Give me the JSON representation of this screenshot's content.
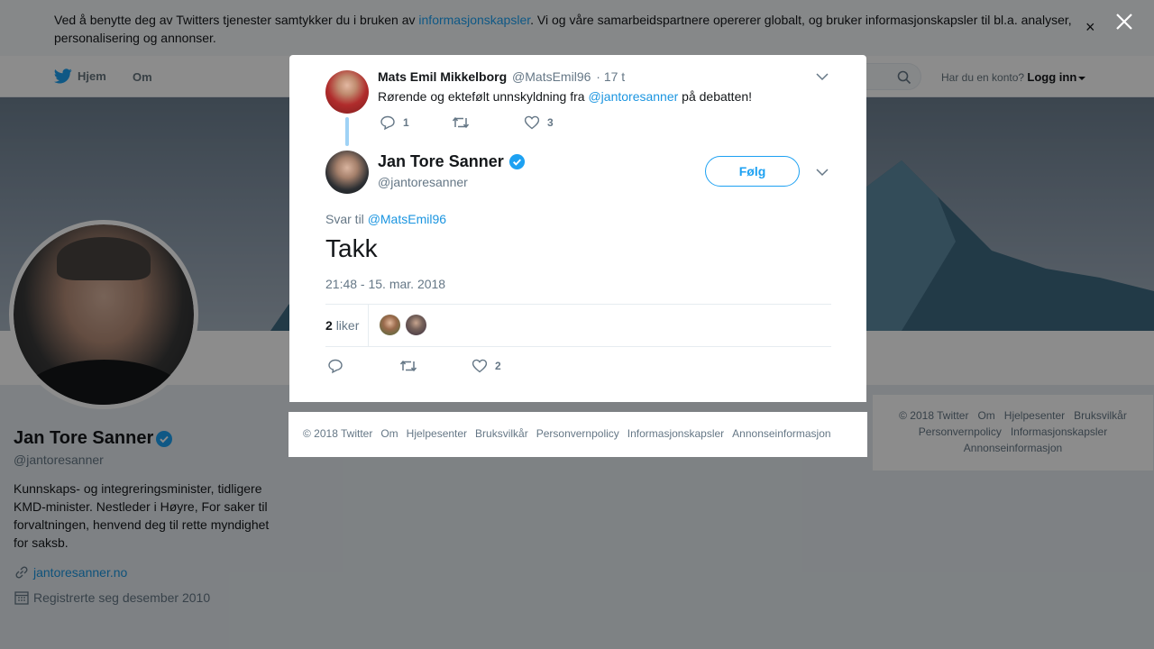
{
  "cookie_banner": {
    "text_before": "Ved å benytte deg av Twitters tjenester samtykker du i bruken av ",
    "link": "informasjonskapsler",
    "text_after": ". Vi og våre samarbeidspartnere opererer globalt, og bruker informasjonskapsler til bl.a. analyser, personalisering og annonser.",
    "close_glyph": "×"
  },
  "topnav": {
    "home": "Hjem",
    "about": "Om",
    "login_prompt": "Har du en konto?",
    "login": "Logg inn"
  },
  "profile": {
    "name": "Jan Tore Sanner",
    "handle": "@jantoresanner",
    "bio": "Kunnskaps- og integreringsminister, tidligere KMD-minister. Nestleder i Høyre, For saker til forvaltningen, henvend deg til rette myndighet for saksb.",
    "website": "jantoresanner.no",
    "joined": "Registrerte seg desember 2010"
  },
  "right_footer": {
    "items": [
      "© 2018 Twitter",
      "Om",
      "Hjelpesenter",
      "Bruksvilkår",
      "Personvernpolicy",
      "Informasjonskapsler",
      "Annonseinformasjon"
    ]
  },
  "modal": {
    "parent_tweet": {
      "name": "Mats Emil Mikkelborg",
      "handle": "@MatsEmil96",
      "time": "· 17 t",
      "text_before": "Rørende og ektefølt unnskyldning fra ",
      "mention": "@jantoresanner",
      "text_after": " på debatten!",
      "replies": "1",
      "retweets": "",
      "likes": "3"
    },
    "main_tweet": {
      "name": "Jan Tore Sanner",
      "handle": "@jantoresanner",
      "follow_label": "Følg",
      "reply_to_label": "Svar til",
      "reply_to_handle": "@MatsEmil96",
      "text": "Takk",
      "timestamp": "21:48 - 15. mar. 2018",
      "likes_count": "2",
      "likes_label": "liker",
      "action_replies": "",
      "action_retweets": "",
      "action_likes": "2"
    },
    "footer": {
      "items": [
        "© 2018 Twitter",
        "Om",
        "Hjelpesenter",
        "Bruksvilkår",
        "Personvernpolicy",
        "Informasjonskapsler",
        "Annonseinformasjon"
      ]
    }
  },
  "colors": {
    "accent": "#1da1f2",
    "link": "#1b95e0",
    "muted": "#657786",
    "overlay": "rgba(0,0,0,0.45)"
  },
  "icons": [
    "twitter-bird-icon",
    "search-icon",
    "caret-down-icon",
    "verified-badge-icon",
    "link-icon",
    "calendar-icon",
    "close-icon",
    "chevron-down-icon",
    "reply-icon",
    "retweet-icon",
    "heart-icon"
  ]
}
